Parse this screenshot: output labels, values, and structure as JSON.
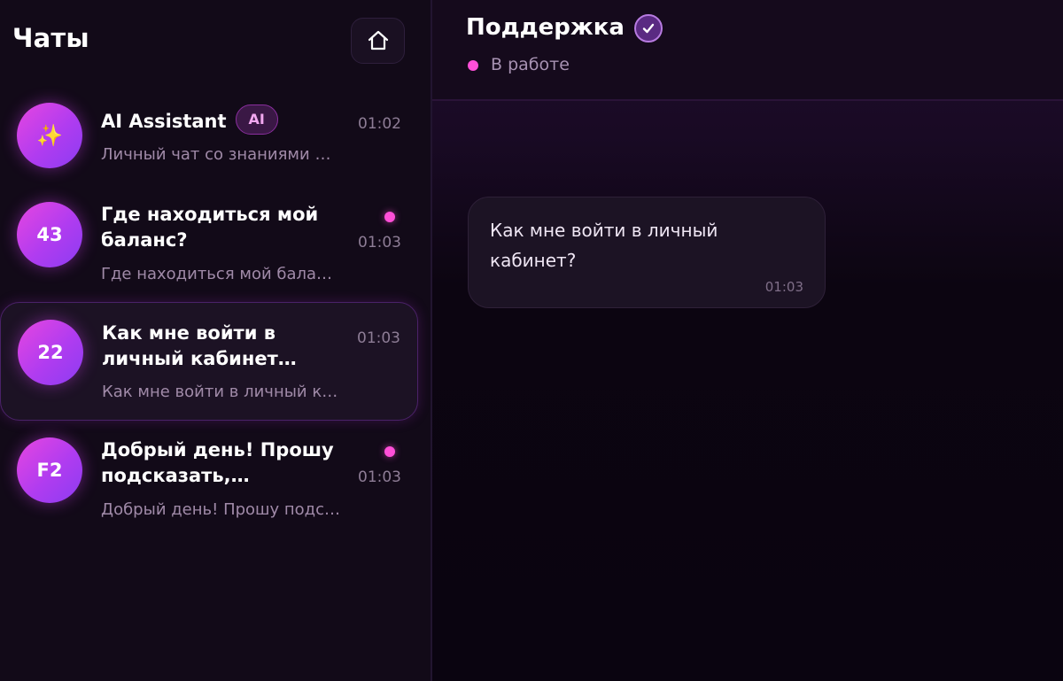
{
  "sidebar": {
    "title": "Чаты",
    "home_icon": "home-icon",
    "chats": [
      {
        "avatar": "✨",
        "name": "AI Assistant",
        "badge": "AI",
        "preview": "Личный чат со знаниями о вашем бизнесе",
        "time": "01:02",
        "unread": false,
        "active": false
      },
      {
        "avatar": "43",
        "name": "Где находиться мой баланс?",
        "preview": "Где находиться мой баланс?",
        "time": "01:03",
        "unread": true,
        "active": false
      },
      {
        "avatar": "22",
        "name": "Как мне войти в личный кабинет…",
        "preview": "Как мне войти в личный кабинет?",
        "time": "01:03",
        "unread": false,
        "active": true
      },
      {
        "avatar": "F2",
        "name": "Добрый день! Прошу подсказать,…",
        "preview": "Добрый день! Прошу подсказать",
        "time": "01:03",
        "unread": true,
        "active": false
      }
    ]
  },
  "conversation": {
    "title": "Поддержка",
    "verified_icon": "checkmark-icon",
    "status": "В работе",
    "messages": [
      {
        "text": "Как мне войти в личный кабинет?",
        "time": "01:03"
      }
    ]
  },
  "colors": {
    "accent": "#ff4fd8",
    "avatar_gradient_start": "#e646e0",
    "avatar_gradient_end": "#8c3cf2",
    "background": "#0f0714"
  }
}
